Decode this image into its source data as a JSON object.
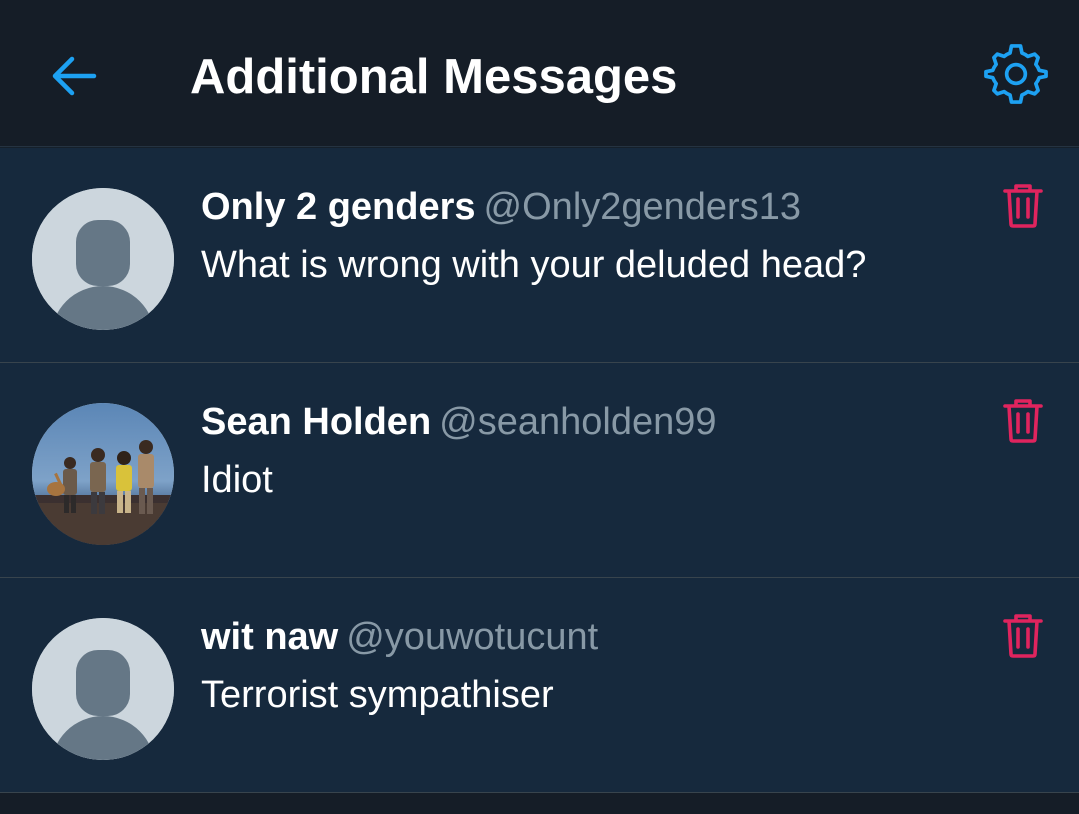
{
  "header": {
    "title": "Additional Messages",
    "back_icon": "arrow-left-icon",
    "settings_icon": "gear-icon"
  },
  "colors": {
    "accent": "#1da1f2",
    "delete": "#e0245e",
    "background": "#15202b",
    "secondary_text": "#8899a6"
  },
  "messages": [
    {
      "name": "Only 2 genders",
      "handle": "@Only2genders13",
      "text": "What is wrong with your deluded head?",
      "avatar": "default-avatar",
      "delete_icon": "trash-icon"
    },
    {
      "name": "Sean Holden",
      "handle": "@seanholden99",
      "text": "Idiot",
      "avatar": "photo-avatar",
      "delete_icon": "trash-icon"
    },
    {
      "name": "wit naw",
      "handle": "@youwotucunt",
      "text": "Terrorist sympathiser",
      "avatar": "default-avatar",
      "delete_icon": "trash-icon"
    }
  ]
}
